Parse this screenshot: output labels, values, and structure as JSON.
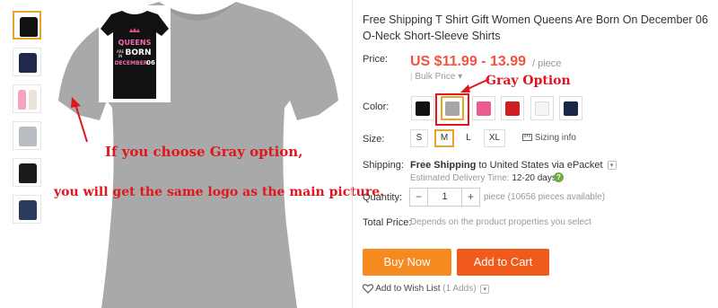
{
  "colors": {
    "accent": "#f3523f",
    "annotation": "#e0161c",
    "selection": "#e8a32b",
    "buy": "#f58a21",
    "cart": "#f05a1b"
  },
  "thumbnails": [
    {
      "name": "black-print",
      "color": "#111111"
    },
    {
      "name": "navy",
      "color": "#1f2a4a"
    },
    {
      "name": "two-models",
      "color": "#f0a0b8"
    },
    {
      "name": "gray",
      "color": "#b9bcc0"
    },
    {
      "name": "black",
      "color": "#1a1a1a"
    },
    {
      "name": "navy-2",
      "color": "#2a3a5e"
    }
  ],
  "main_image": {
    "shirt_color": "#a9a9a9",
    "inset_print_lines": [
      "QUEENS",
      "ARE",
      "BORN",
      "IN",
      "DECEMBER",
      "06"
    ]
  },
  "annotations": {
    "note_line1": "If you choose Gray option,",
    "note_line2": "you will get the same logo as the main picture.",
    "gray_option": "Gray Option"
  },
  "product": {
    "title": "Free Shipping T Shirt Gift Women Queens Are Born On December 06 O-Neck Short-Sleeve Shirts",
    "price_label": "Price:",
    "price": "US $11.99 - 13.99",
    "price_unit": "/ piece",
    "bulk_price": "Bulk Price",
    "color_label": "Color:",
    "color_swatches": [
      {
        "name": "black",
        "color": "#121212",
        "selected": false
      },
      {
        "name": "gray",
        "color": "#a7a7a7",
        "selected": true
      },
      {
        "name": "pink",
        "color": "#ec5a8f",
        "selected": false
      },
      {
        "name": "red",
        "color": "#d31d25",
        "selected": false
      },
      {
        "name": "white",
        "color": "#f4f4f4",
        "selected": false
      },
      {
        "name": "navy",
        "color": "#1b2747",
        "selected": false
      }
    ],
    "size_label": "Size:",
    "sizes": [
      "S",
      "M",
      "L",
      "XL"
    ],
    "selected_size": "M",
    "sizing_info": "Sizing info",
    "shipping_label": "Shipping:",
    "shipping_free": "Free Shipping",
    "shipping_dest": "to United States via ePacket",
    "delivery_text": "Estimated Delivery Time:",
    "delivery_days": "12-20 days",
    "quantity_label": "Quantity:",
    "quantity_value": "1",
    "quantity_available": "piece (10656 pieces available)",
    "total_label": "Total Price:",
    "total_text": "Depends on the product properties you select",
    "buy_now": "Buy Now",
    "add_to_cart": "Add to Cart",
    "wish_list": "Add to Wish List",
    "wish_count": "(1 Adds)"
  }
}
